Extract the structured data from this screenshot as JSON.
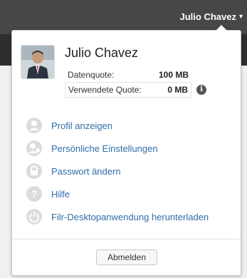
{
  "header": {
    "user_name": "Julio Chavez",
    "caret": "▾"
  },
  "profile": {
    "name": "Julio Chavez",
    "quota_label": "Datenquote:",
    "quota_value": "100 MB",
    "used_label": "Verwendete Quote:",
    "used_value": "0 MB",
    "info_glyph": "i"
  },
  "menu": [
    {
      "label": "Profil anzeigen",
      "icon": "person-icon"
    },
    {
      "label": "Persönliche Einstellungen",
      "icon": "person-settings-icon"
    },
    {
      "label": "Passwort ändern",
      "icon": "lock-icon"
    },
    {
      "label": "Hilfe",
      "icon": "help-icon"
    },
    {
      "label": "Filr-Desktopanwendung herunterladen",
      "icon": "power-icon"
    }
  ],
  "logout_label": "Abmelden",
  "colors": {
    "link": "#2f6ea8",
    "topbar": "#474747",
    "icon_bg": "#dcdcdc"
  }
}
